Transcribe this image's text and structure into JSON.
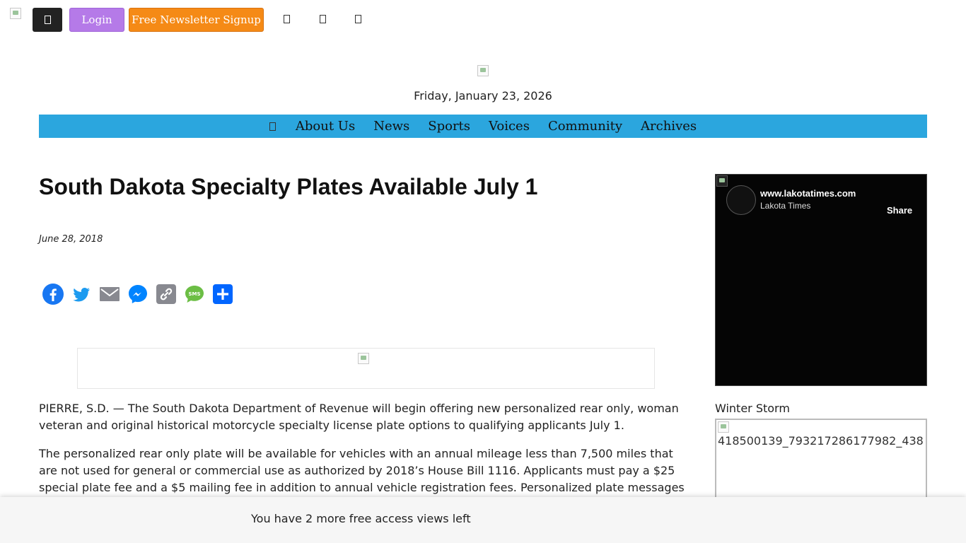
{
  "topbar": {
    "login_label": "Login",
    "newsletter_label": "Free Newsletter Signup"
  },
  "masthead": {
    "date": "Friday, January 23, 2026"
  },
  "nav": {
    "items": [
      "About Us",
      "News",
      "Sports",
      "Voices",
      "Community",
      "Archives"
    ]
  },
  "article": {
    "headline": "South Dakota Specialty Plates Available July 1",
    "date": "June 28, 2018",
    "paragraphs": [
      "PIERRE, S.D. — The South Dakota Department of Revenue will begin offering new personalized rear only, woman veteran and original historical motorcycle specialty license plate options to qualifying applicants July 1.",
      "The personalized rear only plate will be available for vehicles with an annual mileage less than 7,500 miles that are not used for general or commercial use as authorized by 2018’s House Bill 1116. Applicants must pay a $25 special plate fee and a $5 mailing fee in addition to annual vehicle registration fees. Personalized plate messages"
    ]
  },
  "share": {
    "icons": [
      "facebook-icon",
      "twitter-icon",
      "email-icon",
      "messenger-icon",
      "copy-link-icon",
      "sms-icon",
      "share-icon"
    ],
    "colors": {
      "facebook": "#1877f2",
      "twitter": "#1d9bf0",
      "email": "#888990",
      "messenger": "#0084ff",
      "copy": "#888990",
      "sms": "#6cbe45",
      "share": "#0166ff"
    }
  },
  "sidebar": {
    "video_url": "www.lakotatimes.com",
    "video_channel": "Lakota Times",
    "video_share": "Share",
    "widget_title": "Winter Storm",
    "widget_image_alt": "418500139_793217286177982_438"
  },
  "paywall": {
    "message": "You have 2 more free access views left"
  },
  "colors": {
    "nav_bg": "#2ba6de",
    "login_bg": "#b57ae8",
    "newsletter_bg": "#f58a16"
  }
}
